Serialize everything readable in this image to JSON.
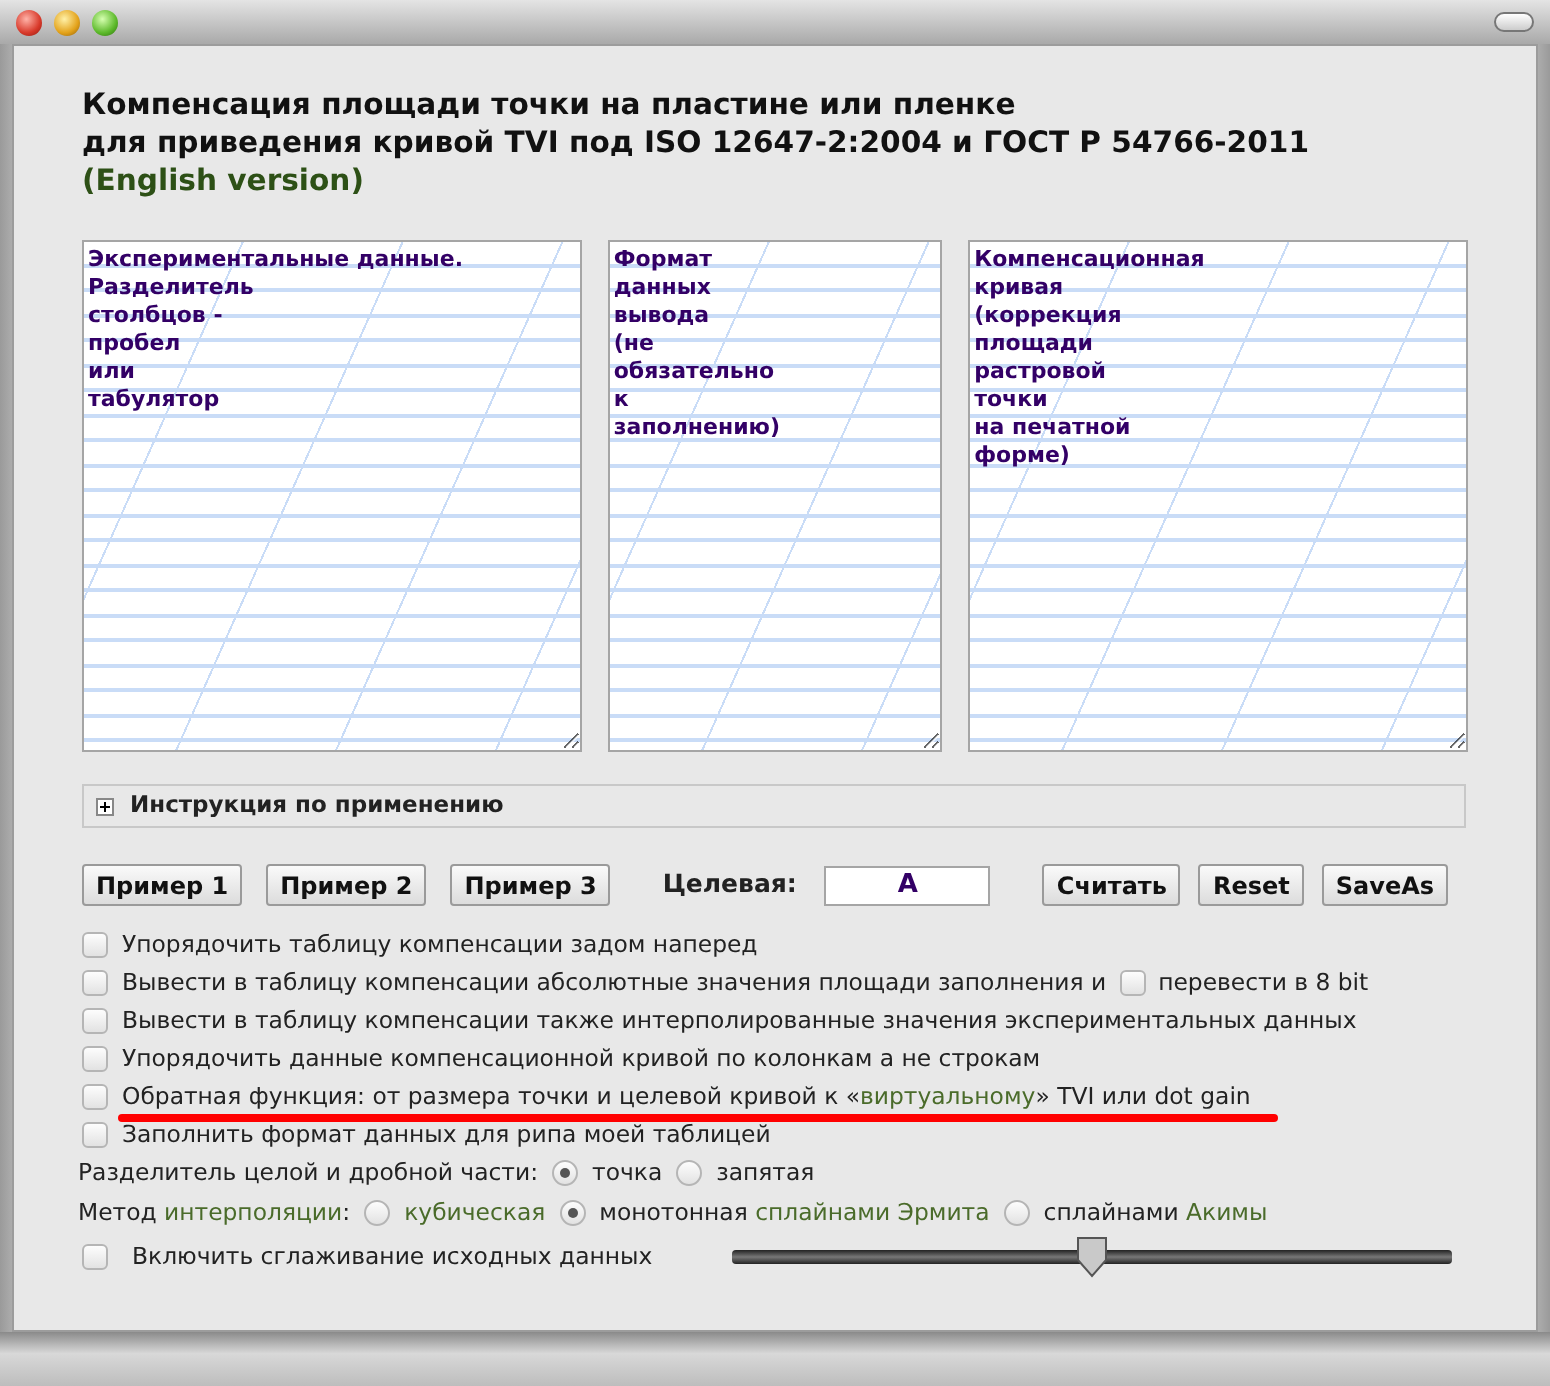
{
  "header": {
    "lines": [
      "Компенсация площади точки на пластине или пленке",
      "для приведения кривой TVI под ISO 12647-2:2004 и ГОСТ Р 54766-2011"
    ],
    "english_link": "(English version)"
  },
  "fields": [
    {
      "placeholder": "Экспериментальные данные.\nРазделитель\nстолбцов -\nпробел\nили\nтабулятор"
    },
    {
      "placeholder": "Формат\nданных\nвывода\n(не\nобязательно\nк\nзаполнению)"
    },
    {
      "placeholder": "Компенсационная\nкривая\n(коррекция\nплощади\nрастровой\nточки\nна печатной\nформе)"
    }
  ],
  "instructions": {
    "label": "Инструкция по применению",
    "expanded": false
  },
  "example_buttons": [
    "Пример 1",
    "Пример 2",
    "Пример 3"
  ],
  "target": {
    "label": "Целевая:",
    "value": "A"
  },
  "action_buttons": [
    "Считать",
    "Reset",
    "SaveAs"
  ],
  "options": [
    {
      "segments": [
        {
          "text": "Упорядочить таблицу компенсации задом наперед",
          "accent": false
        }
      ],
      "checked": false,
      "underlined": false
    },
    {
      "segments": [
        {
          "text": "Вывести в таблицу компенсации абсолютные значения площади заполнения и",
          "accent": false
        }
      ],
      "checked": false,
      "underlined": false,
      "extra": {
        "label": "перевести в 8 bit",
        "checked": false
      }
    },
    {
      "segments": [
        {
          "text": "Вывести в таблицу компенсации также интерполированные значения экспериментальных данных",
          "accent": false
        }
      ],
      "checked": false,
      "underlined": false
    },
    {
      "segments": [
        {
          "text": "Упорядочить данные компенсационной кривой по колонкам а не строкам",
          "accent": false
        }
      ],
      "checked": false,
      "underlined": false
    },
    {
      "segments": [
        {
          "text": "Обратная функция: от размера точки и целевой кривой к «",
          "accent": false
        },
        {
          "text": "виртуальному",
          "accent": true
        },
        {
          "text": "» TVI или dot gain",
          "accent": false
        }
      ],
      "checked": false,
      "underlined": true
    },
    {
      "segments": [
        {
          "text": "Заполнить формат данных для рипа моей таблицей",
          "accent": false
        }
      ],
      "checked": false,
      "underlined": false
    }
  ],
  "separator": {
    "label": [
      {
        "text": "Разделитель целой и дробной части:",
        "accent": false
      }
    ],
    "choices": [
      {
        "segments": [
          {
            "text": "точка",
            "accent": false
          }
        ],
        "selected": true
      },
      {
        "segments": [
          {
            "text": "запятая",
            "accent": false
          }
        ],
        "selected": false
      }
    ]
  },
  "interpolation": {
    "label": [
      {
        "text": "Метод ",
        "accent": false
      },
      {
        "text": "интерполяции",
        "accent": true
      },
      {
        "text": ":",
        "accent": false
      }
    ],
    "choices": [
      {
        "segments": [
          {
            "text": "кубическая",
            "accent": true
          }
        ],
        "selected": false
      },
      {
        "segments": [
          {
            "text": "монотонная ",
            "accent": false
          },
          {
            "text": "сплайнами Эрмита",
            "accent": true
          }
        ],
        "selected": true
      },
      {
        "segments": [
          {
            "text": "сплайнами ",
            "accent": false
          },
          {
            "text": "Акимы",
            "accent": true
          }
        ],
        "selected": false
      }
    ]
  },
  "smoothing": {
    "label": "Включить сглаживание исходных данных",
    "checked": false,
    "level": 0.5
  }
}
